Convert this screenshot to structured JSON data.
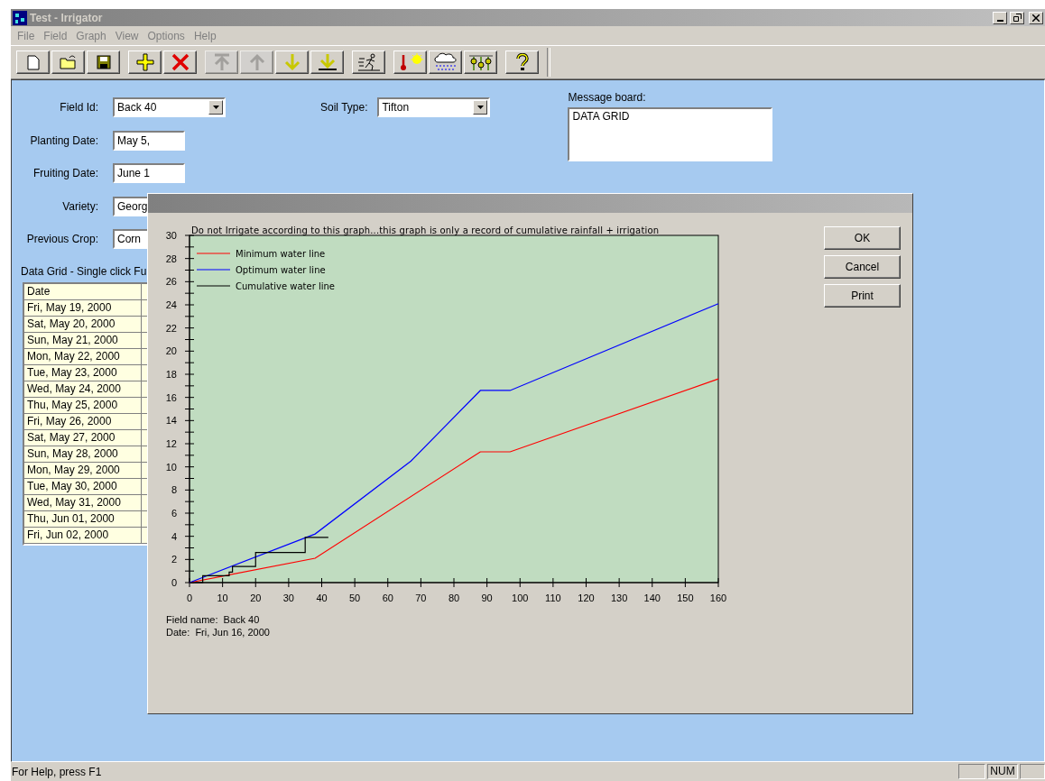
{
  "window": {
    "title": "Test - Irrigator"
  },
  "menu": [
    "File",
    "Field",
    "Graph",
    "View",
    "Options",
    "Help"
  ],
  "toolbar": [
    [
      {
        "kind": "new",
        "disabled": false
      },
      {
        "kind": "open",
        "disabled": false
      },
      {
        "kind": "save",
        "disabled": false
      }
    ],
    [
      {
        "kind": "add",
        "disabled": false
      },
      {
        "kind": "delete",
        "disabled": false
      }
    ],
    [
      {
        "kind": "first",
        "disabled": true
      },
      {
        "kind": "up",
        "disabled": true
      },
      {
        "kind": "down",
        "disabled": false
      },
      {
        "kind": "last",
        "disabled": false
      }
    ],
    [
      {
        "kind": "run",
        "disabled": false
      }
    ],
    [
      {
        "kind": "weather",
        "disabled": false
      },
      {
        "kind": "rain",
        "disabled": false
      },
      {
        "kind": "plants",
        "disabled": false
      }
    ],
    [
      {
        "kind": "help",
        "disabled": false
      }
    ]
  ],
  "form": {
    "fields": [
      {
        "label": "Field Id:",
        "value": "Back 40",
        "kind": "dropdown"
      },
      {
        "label": "Planting Date:",
        "value": "May 5,",
        "kind": "text"
      },
      {
        "label": "Fruiting Date:",
        "value": "June 1",
        "kind": "text"
      },
      {
        "label": "Variety:",
        "value": "Georg",
        "kind": "text"
      },
      {
        "label": "Previous Crop:",
        "value": "Corn",
        "kind": "text"
      }
    ],
    "soil_type": {
      "label": "Soil Type:",
      "value": "Tifton"
    },
    "message_board": {
      "label": "Message board:",
      "value": "DATA GRID"
    }
  },
  "data_grid": {
    "label": "Data Grid - Single click Fu",
    "columns": [
      "Date"
    ],
    "rows": [
      "Fri, May 19, 2000",
      "Sat, May 20, 2000",
      "Sun, May 21, 2000",
      "Mon, May 22, 2000",
      "Tue, May 23, 2000",
      "Wed, May 24, 2000",
      "Thu, May 25, 2000",
      "Fri, May 26, 2000",
      "Sat, May 27, 2000",
      "Sun, May 28, 2000",
      "Mon, May 29, 2000",
      "Tue, May 30, 2000",
      "Wed, May 31, 2000",
      "Thu, Jun 01, 2000",
      "Fri, Jun 02, 2000"
    ]
  },
  "dialog": {
    "chart_data": {
      "type": "line",
      "legend": "upper left",
      "title": "Do not Irrigate according to this graph...this graph is only a record of cumulative rainfall + irrigation",
      "xlim": [
        0,
        160
      ],
      "ylim": [
        0,
        30
      ],
      "xticks": [
        0,
        10,
        20,
        30,
        40,
        50,
        60,
        70,
        80,
        90,
        100,
        110,
        120,
        130,
        140,
        150,
        160
      ],
      "yticks": [
        0,
        2,
        4,
        6,
        8,
        10,
        12,
        14,
        16,
        18,
        20,
        22,
        24,
        26,
        28,
        30
      ],
      "series": [
        {
          "name": "Minimum water line",
          "color": "#ff0000",
          "x": [
            0,
            38,
            88,
            97,
            160
          ],
          "values": [
            0,
            2.1,
            11.3,
            11.3,
            17.6
          ]
        },
        {
          "name": "Optimum water line",
          "color": "#0000ff",
          "x": [
            0,
            38,
            67,
            88,
            97,
            160
          ],
          "values": [
            0,
            4.2,
            10.5,
            16.6,
            16.6,
            24.1
          ]
        },
        {
          "name": "Cumulative water line",
          "color": "#000000",
          "x": [
            0,
            4,
            4,
            12,
            12,
            13,
            13,
            20,
            20,
            35,
            35,
            42
          ],
          "values": [
            0,
            0,
            0.6,
            0.6,
            0.9,
            0.9,
            1.4,
            1.4,
            2.6,
            2.6,
            3.9,
            3.9
          ]
        }
      ]
    },
    "info": [
      "Field name:  Back 40",
      "Date:  Fri, Jun 16, 2000"
    ],
    "buttons": [
      "OK",
      "Cancel",
      "Print"
    ]
  },
  "status_bar": {
    "message": "For Help, press F1",
    "indicators": [
      "NUM"
    ]
  }
}
